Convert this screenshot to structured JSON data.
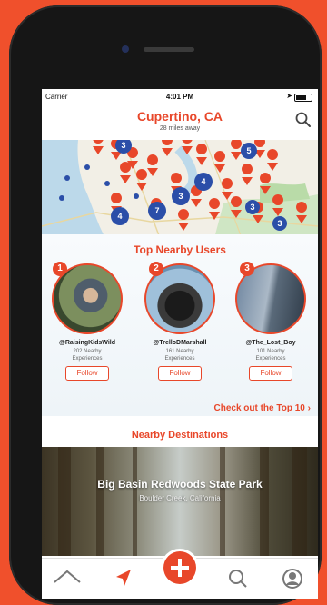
{
  "status_bar": {
    "carrier": "Carrier",
    "time": "4:01 PM"
  },
  "header": {
    "city": "Cupertino, CA",
    "distance": "28 miles away"
  },
  "map": {
    "marker_counts": [
      "5",
      "3",
      "4",
      "3",
      "7",
      "3",
      "4",
      "3"
    ]
  },
  "top_users": {
    "title": "Top Nearby Users",
    "follow_label": "Follow",
    "users": [
      {
        "rank": "1",
        "name": "@RaisingKidsWild",
        "count_line1": "202 Nearby",
        "count_line2": "Experiences"
      },
      {
        "rank": "2",
        "name": "@TrelloDMarshall",
        "count_line1": "161 Nearby",
        "count_line2": "Experiences"
      },
      {
        "rank": "3",
        "name": "@The_Lost_Boy",
        "count_line1": "101 Nearby",
        "count_line2": "Experiences"
      }
    ],
    "top10_link": "Check out the Top 10"
  },
  "destinations": {
    "title": "Nearby Destinations",
    "items": [
      {
        "name": "Big Basin Redwoods State Park",
        "location": "Boulder Creek, California"
      }
    ]
  },
  "colors": {
    "accent": "#e8472a",
    "background": "#f0502c"
  }
}
